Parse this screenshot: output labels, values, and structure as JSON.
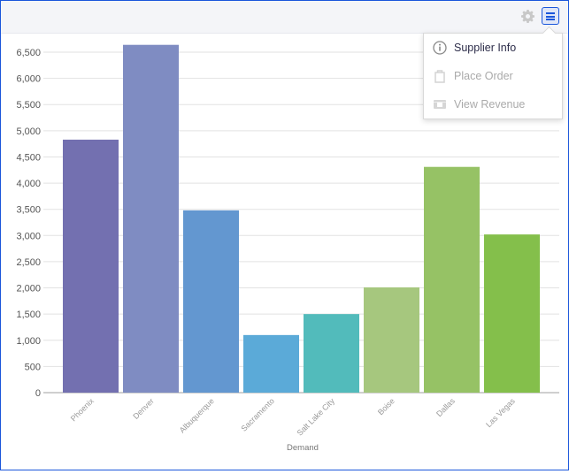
{
  "toolbar": {
    "settings_icon": "gear-icon",
    "menu_icon": "hamburger-menu-icon"
  },
  "menu": {
    "items": [
      {
        "label": "Supplier Info",
        "icon": "info-icon",
        "enabled": true
      },
      {
        "label": "Place Order",
        "icon": "shopping-bag-icon",
        "enabled": false
      },
      {
        "label": "View Revenue",
        "icon": "money-icon",
        "enabled": false
      }
    ]
  },
  "chart_data": {
    "type": "bar",
    "title": "",
    "xlabel": "Demand",
    "ylabel": "",
    "categories": [
      "Phoenix",
      "Denver",
      "Albuquerque",
      "Sacramento",
      "Salt Lake City",
      "Boise",
      "Dallas",
      "Las Vegas"
    ],
    "values": [
      4830,
      6640,
      3480,
      1100,
      1500,
      2010,
      4310,
      3020
    ],
    "colors": [
      "#7370b0",
      "#7f8cc2",
      "#6397d0",
      "#5baad8",
      "#52bbbb",
      "#a6c77e",
      "#96c265",
      "#84bf4b"
    ],
    "ylim": [
      0,
      6500
    ],
    "yticks": [
      0,
      500,
      1000,
      1500,
      2000,
      2500,
      3000,
      3500,
      4000,
      4500,
      5000,
      5500,
      6000,
      6500
    ],
    "ytick_labels": [
      "0",
      "500",
      "1,000",
      "1,500",
      "2,000",
      "2,500",
      "3,000",
      "3,500",
      "4,000",
      "4,500",
      "5,000",
      "5,500",
      "6,000",
      "6,500"
    ],
    "grid": true,
    "legend": "none"
  }
}
